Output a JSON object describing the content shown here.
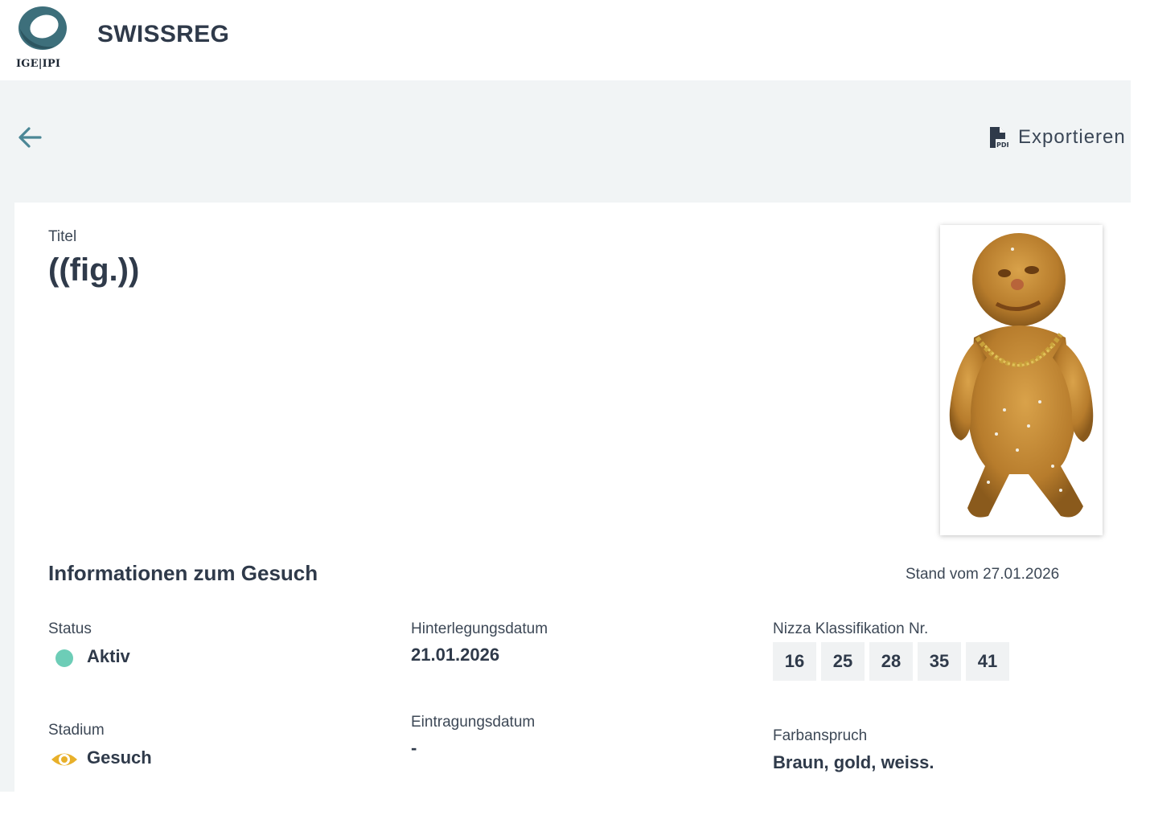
{
  "header": {
    "logo_org": "IGE|IPI",
    "app_title": "SWISSREG"
  },
  "toolbar": {
    "back_icon": "arrow-left-icon",
    "export_icon": "pdf-file-icon",
    "export_label": "Exportieren"
  },
  "record": {
    "title_label": "Titel",
    "title_value": "((fig.))",
    "image_alt": "gingerbread-like bread figure wearing a gold chain"
  },
  "info": {
    "section_title": "Informationen zum Gesuch",
    "stand": "Stand vom 27.01.2026",
    "status_label": "Status",
    "status_value": "Aktiv",
    "status_color": "#6dcdb7",
    "stadium_label": "Stadium",
    "stadium_value": "Gesuch",
    "stadium_icon": "eye-icon",
    "stadium_color": "#e8b02a",
    "filing_date_label": "Hinterlegungsdatum",
    "filing_date_value": "21.01.2026",
    "registration_date_label": "Eintragungsdatum",
    "registration_date_value": "-",
    "nice_label": "Nizza Klassifikation Nr.",
    "nice_classes": [
      "16",
      "25",
      "28",
      "35",
      "41"
    ],
    "color_claim_label": "Farbanspruch",
    "color_claim_value": "Braun, gold, weiss."
  },
  "colors": {
    "accent": "#4b8796",
    "band": "#f1f4f5",
    "text": "#2f3a4a"
  }
}
